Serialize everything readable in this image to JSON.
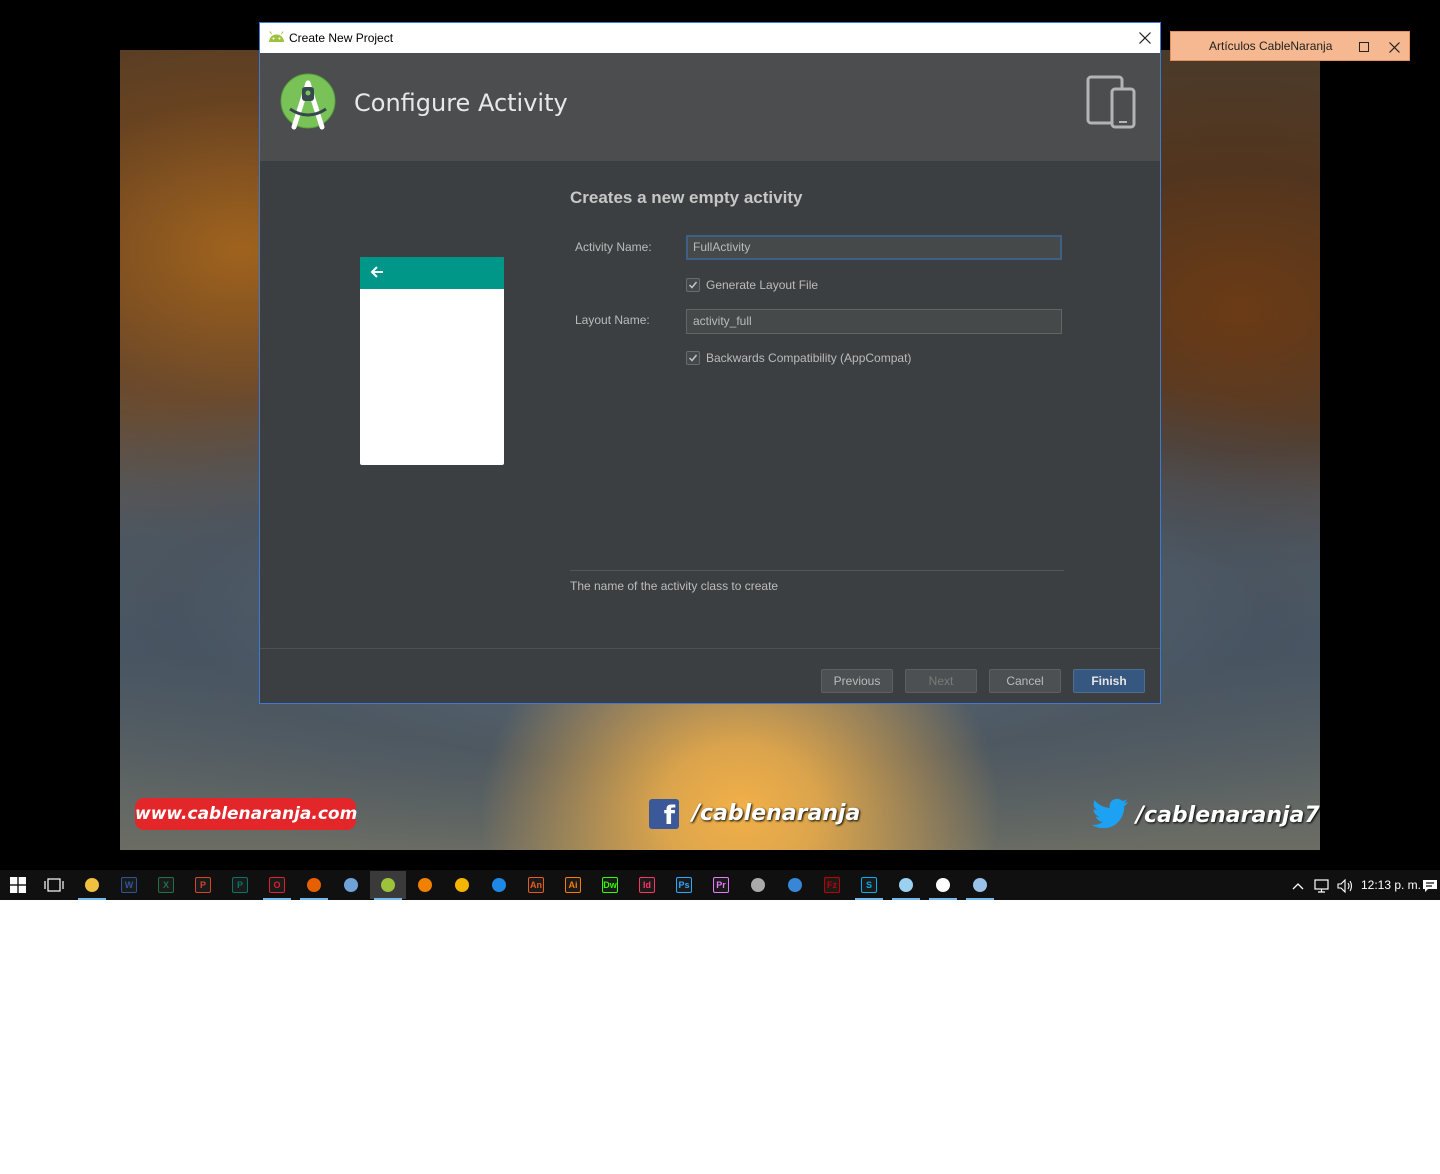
{
  "dialog": {
    "window_title": "Create New Project",
    "header_title": "Configure Activity",
    "form_title": "Creates a new empty activity",
    "activity_name_label": "Activity Name:",
    "activity_name_value": "FullActivity",
    "generate_layout_label": "Generate Layout File",
    "generate_layout_checked": true,
    "layout_name_label": "Layout Name:",
    "layout_name_value": "activity_full",
    "backwards_compat_label": "Backwards Compatibility (AppCompat)",
    "backwards_compat_checked": true,
    "hint": "The name of the activity class to create",
    "buttons": {
      "previous": "Previous",
      "next": "Next",
      "cancel": "Cancel",
      "finish": "Finish"
    },
    "accent_color": "#3d7ad8",
    "preview_appbar_color": "#009688"
  },
  "side_window": {
    "title": "Artículos CableNaranja"
  },
  "wallpaper": {
    "website": "www.cablenaranja.com",
    "facebook": "/cablenaranja",
    "twitter": "/cablenaranja7"
  },
  "taskbar": {
    "apps": [
      {
        "name": "file-explorer",
        "label": "",
        "color": "#f0c040",
        "running": true
      },
      {
        "name": "word",
        "label": "W",
        "color": "#2b579a",
        "running": false
      },
      {
        "name": "excel",
        "label": "X",
        "color": "#217346",
        "running": false
      },
      {
        "name": "powerpoint",
        "label": "P",
        "color": "#d24726",
        "running": false
      },
      {
        "name": "publisher",
        "label": "P",
        "color": "#077568",
        "running": false
      },
      {
        "name": "opera",
        "label": "O",
        "color": "#e0202a",
        "running": true
      },
      {
        "name": "firefox",
        "label": "",
        "color": "#e66000",
        "running": true
      },
      {
        "name": "virtualbox",
        "label": "",
        "color": "#6fa3d8",
        "running": false
      },
      {
        "name": "android-studio",
        "label": "",
        "color": "#9dc23b",
        "running": true
      },
      {
        "name": "vlc",
        "label": "",
        "color": "#f08000",
        "running": false
      },
      {
        "name": "arduino-like",
        "label": "",
        "color": "#f4b400",
        "running": false
      },
      {
        "name": "3d-app",
        "label": "",
        "color": "#1e88e5",
        "running": false
      },
      {
        "name": "animate",
        "label": "An",
        "color": "#e35d1f",
        "running": false
      },
      {
        "name": "illustrator",
        "label": "Ai",
        "color": "#ff7c00",
        "running": false
      },
      {
        "name": "dreamweaver",
        "label": "Dw",
        "color": "#35fa00",
        "running": false
      },
      {
        "name": "indesign",
        "label": "Id",
        "color": "#ff3366",
        "running": false
      },
      {
        "name": "photoshop",
        "label": "Ps",
        "color": "#31a8ff",
        "running": false
      },
      {
        "name": "premiere",
        "label": "Pr",
        "color": "#e77bff",
        "running": false
      },
      {
        "name": "obs",
        "label": "",
        "color": "#aaaaaa",
        "running": false
      },
      {
        "name": "app-blue-box",
        "label": "",
        "color": "#3a86d6",
        "running": false
      },
      {
        "name": "filezilla",
        "label": "Fz",
        "color": "#bf0000",
        "running": false
      },
      {
        "name": "skype",
        "label": "S",
        "color": "#00aff0",
        "running": true
      },
      {
        "name": "notepad",
        "label": "",
        "color": "#9ad0f0",
        "running": true
      },
      {
        "name": "settings",
        "label": "",
        "color": "#ffffff",
        "running": true
      },
      {
        "name": "paint",
        "label": "",
        "color": "#9ac1e8",
        "running": true
      }
    ],
    "clock": "12:13 p. m."
  }
}
